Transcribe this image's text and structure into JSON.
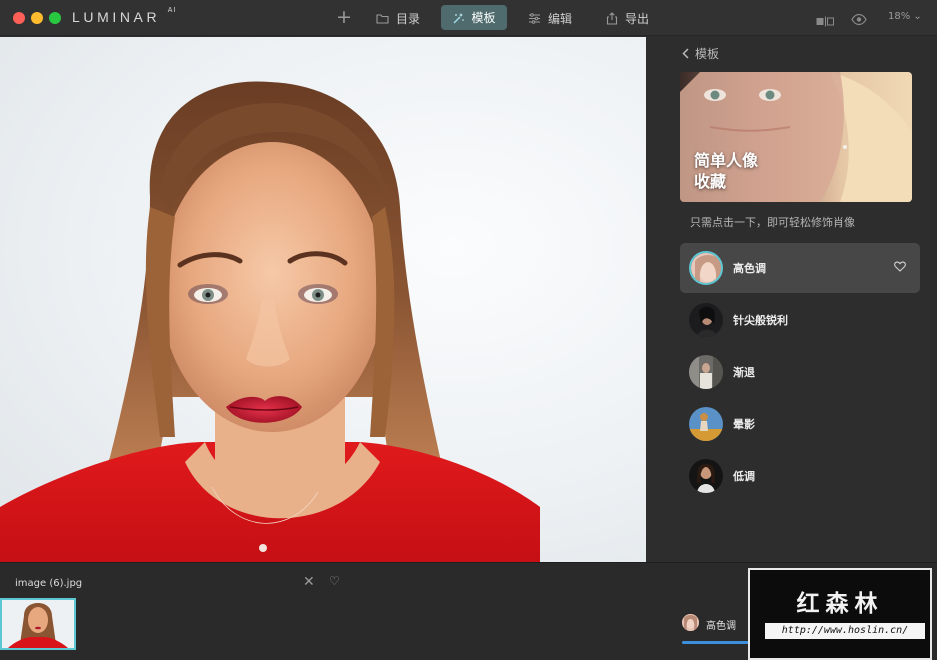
{
  "app": {
    "logo": "LUMINAR",
    "logo_suffix": "AI",
    "zoom": "18%"
  },
  "toolbar": {
    "add_label": "+",
    "catalog_label": "目录",
    "template_label": "模板",
    "edit_label": "编辑",
    "export_label": "导出",
    "zoom_chevron": "⌄"
  },
  "panel": {
    "back_label": "模板",
    "hero_title": "简单人像\n收藏",
    "hero_desc": "只需点击一下，即可轻松修饰肖像",
    "presets": [
      {
        "label": "高色调",
        "active": true,
        "favorite_icon": "heart-outline-icon"
      },
      {
        "label": "针尖般锐利",
        "active": false
      },
      {
        "label": "渐退",
        "active": false
      },
      {
        "label": "晕影",
        "active": false
      },
      {
        "label": "低调",
        "active": false
      }
    ]
  },
  "filmstrip": {
    "file_name": "image (6).jpg",
    "close_glyph": "✕",
    "heart_glyph": "♡"
  },
  "bottom": {
    "preset_name": "高色调",
    "heart_glyph": "♡",
    "more_glyph": "···",
    "amount_fraction": 0.85
  },
  "watermark": {
    "title": "红森林",
    "url": "http://www.hoslin.cn/"
  },
  "colors": {
    "accent": "#5ec7d4",
    "template_tab": "#4f6b6d",
    "slider": "#3d8fdc"
  }
}
